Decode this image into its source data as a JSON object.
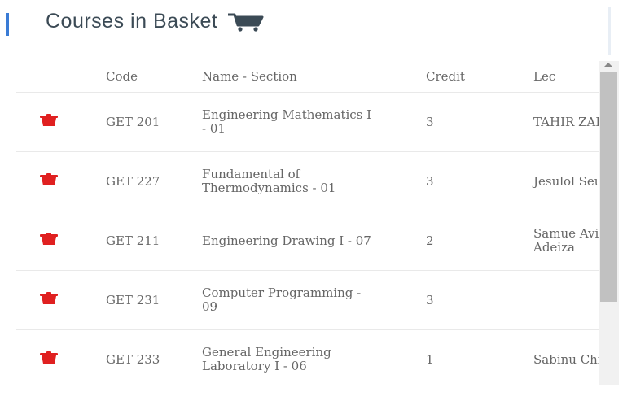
{
  "header": {
    "title": "Courses in Basket",
    "cart_icon": "shopping-cart-icon",
    "accent_color": "#3a7bd5"
  },
  "table": {
    "columns": [
      "Code",
      "Name - Section",
      "Credit",
      "Lec"
    ],
    "delete_icon": "trash-icon",
    "delete_color": "#e02020",
    "rows": [
      {
        "code": "GET 201",
        "name": "Engineering Mathematics I - 01",
        "credit": "3",
        "lec": "TAHIR ZARMA"
      },
      {
        "code": "GET 227",
        "name": "Fundamental of Thermodynamics - 01",
        "credit": "3",
        "lec": "Jesulol Seun"
      },
      {
        "code": "GET 211",
        "name": "Engineering Drawing I - 07",
        "credit": "2",
        "lec": "Samue Avidim Adeiza"
      },
      {
        "code": "GET 231",
        "name": "Computer Programming - 09",
        "credit": "3",
        "lec": ""
      },
      {
        "code": "GET 233",
        "name": "General Engineering Laboratory I - 06",
        "credit": "1",
        "lec": "Sabinu Chinec"
      }
    ]
  }
}
